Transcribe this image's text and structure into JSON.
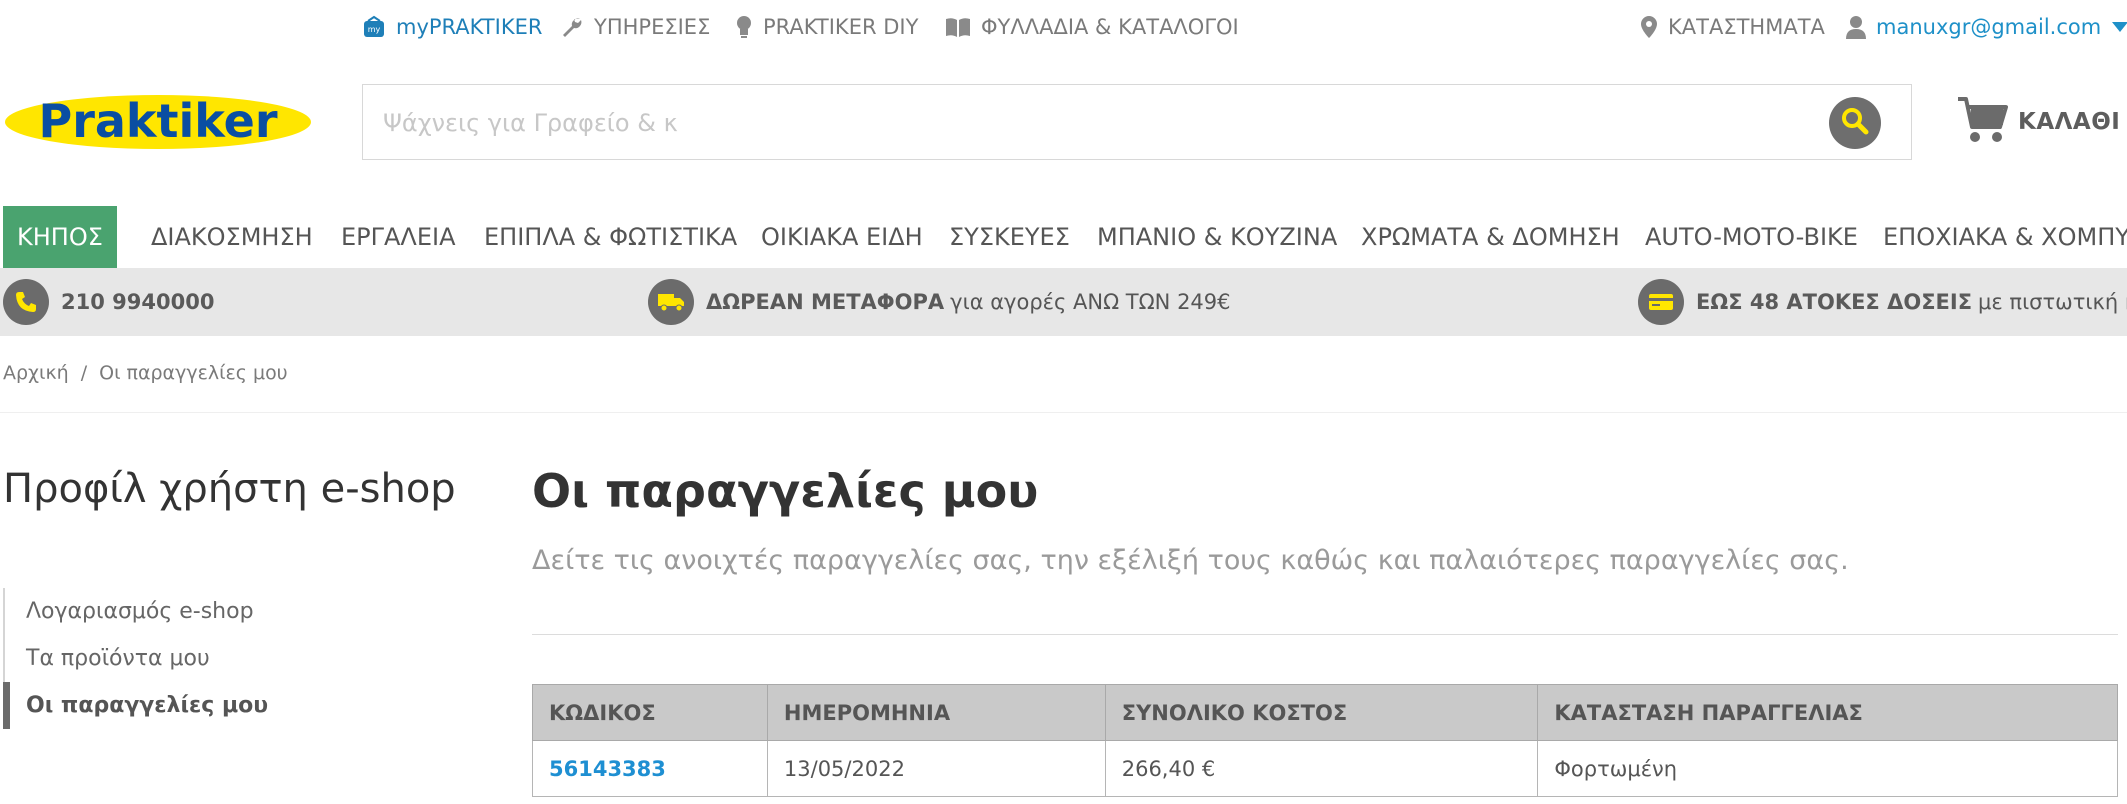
{
  "topbar": {
    "my_praktiker": "myPRAKTIKER",
    "services": "ΥΠΗΡΕΣΙΕΣ",
    "diy": "PRAKTIKER DIY",
    "catalogs": "ΦΥΛΛΑΔΙΑ & ΚΑΤΑΛΟΓΟΙ",
    "stores": "ΚΑΤΑΣΤΗΜΑΤΑ",
    "user_email": "manuxgr@gmail.com"
  },
  "header": {
    "logo_text": "Praktiker",
    "search_placeholder": "Ψάχνεις για Γραφείο & κ",
    "cart_label": "ΚΑΛΑΘΙ"
  },
  "nav": {
    "items": [
      "ΚΗΠΟΣ",
      "ΔΙΑΚΟΣΜΗΣΗ",
      "ΕΡΓΑΛΕΙΑ",
      "ΕΠΙΠΛΑ & ΦΩΤΙΣΤΙΚΑ",
      "ΟΙΚΙΑΚΑ ΕΙΔΗ",
      "ΣΥΣΚΕΥΕΣ",
      "ΜΠΑΝΙΟ & ΚΟΥΖΙΝΑ",
      "ΧΡΩΜΑΤΑ & ΔΟΜΗΣΗ",
      "AUTO-MOTO-BIKE",
      "ΕΠΟΧΙΑΚΑ & ΧΟΜΠΥ"
    ]
  },
  "strip": {
    "phone": "210 9940000",
    "delivery_bold": "ΔΩΡΕΑΝ ΜΕΤΑΦΟΡΑ",
    "delivery_rest": "για αγορές ΑΝΩ ΤΩΝ 249€",
    "installments_bold": "ΕΩΣ 48 ΑΤΟΚΕΣ ΔΟΣΕΙΣ",
    "installments_rest": "με πιστωτική κάρτα"
  },
  "breadcrumb": {
    "home": "Αρχική",
    "separator": "/",
    "current": "Οι παραγγελίες μου"
  },
  "sidebar": {
    "title": "Προφίλ χρήστη e-shop",
    "items": [
      "Λογαριασμός e-shop",
      "Τα προϊόντα μου",
      "Οι παραγγελίες μου"
    ]
  },
  "main": {
    "title": "Οι παραγγελίες μου",
    "subtitle": "Δείτε τις ανοιχτές παραγγελίες σας, την εξέλιξή τους καθώς και παλαιότερες παραγγελίες σας.",
    "table": {
      "headers": [
        "ΚΩΔΙΚΟΣ",
        "ΗΜΕΡΟΜΗΝΙΑ",
        "ΣΥΝΟΛΙΚΟ ΚΟΣΤΟΣ",
        "ΚΑΤΑΣΤΑΣΗ ΠΑΡΑΓΓΕΛΙΑΣ"
      ],
      "rows": [
        [
          "56143383",
          "13/05/2022",
          "266,40 €",
          "Φορτωμένη"
        ]
      ]
    }
  },
  "colors": {
    "accent_green": "#4aa36f",
    "link_blue": "#1e8fd2",
    "logo_yellow": "#ffe600",
    "logo_blue": "#0a4ea2"
  }
}
